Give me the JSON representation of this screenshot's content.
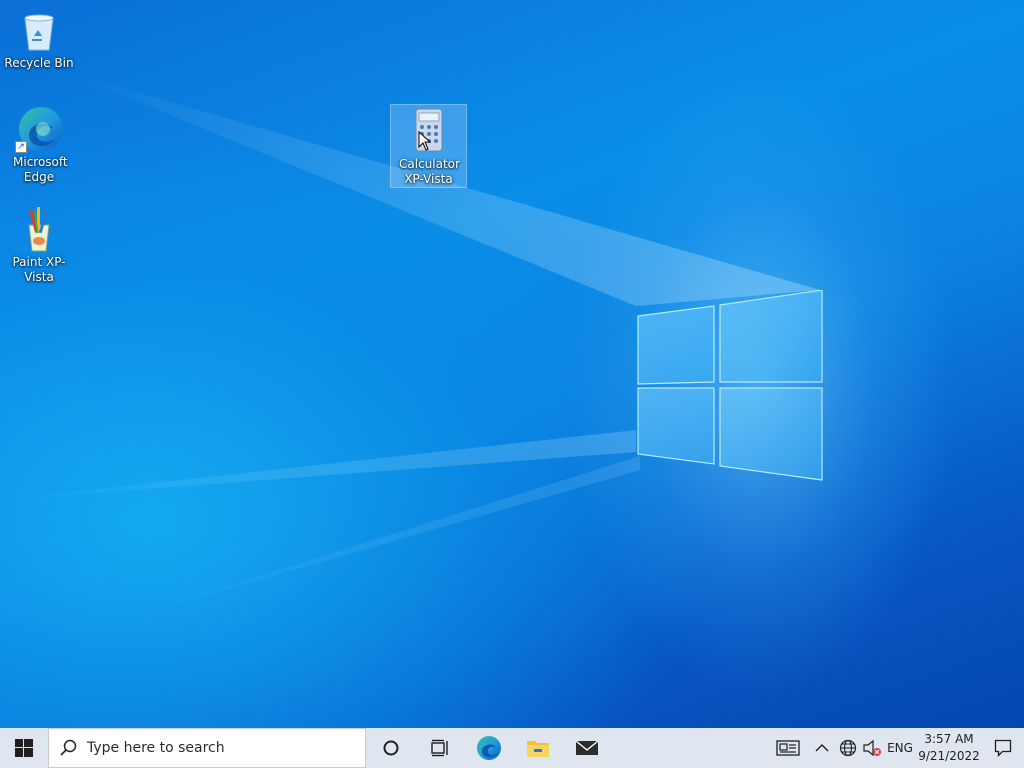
{
  "desktop": {
    "icons": [
      {
        "label": "Recycle Bin",
        "icon": "recycle-bin-icon"
      },
      {
        "label": "Microsoft Edge",
        "icon": "edge-icon",
        "shortcut": true
      },
      {
        "label": "Paint XP-Vista",
        "icon": "paint-icon"
      },
      {
        "label": "Calculator XP-Vista",
        "icon": "calculator-icon",
        "selected": true
      }
    ],
    "wallpaper_colors": {
      "deep": "#0646b0",
      "mid": "#0a8ee8",
      "glow": "#7fd3ff"
    }
  },
  "taskbar": {
    "start_icon": "windows-start-icon",
    "search_placeholder": "Type here to search",
    "pinned": [
      {
        "name": "cortana",
        "icon": "cortana-circle-icon"
      },
      {
        "name": "task-view",
        "icon": "task-view-icon"
      },
      {
        "name": "edge",
        "icon": "edge-icon"
      },
      {
        "name": "file-explorer",
        "icon": "folder-icon"
      },
      {
        "name": "mail",
        "icon": "mail-icon"
      }
    ],
    "tray": {
      "news_icon": "news-widget-icon",
      "chevron_icon": "chevron-up-icon",
      "network_icon": "globe-network-icon",
      "volume_icon": "volume-muted-icon",
      "language": "ENG",
      "time": "3:57 AM",
      "date": "9/21/2022",
      "notifications_icon": "notification-icon"
    },
    "background": "#dfe6ef"
  }
}
